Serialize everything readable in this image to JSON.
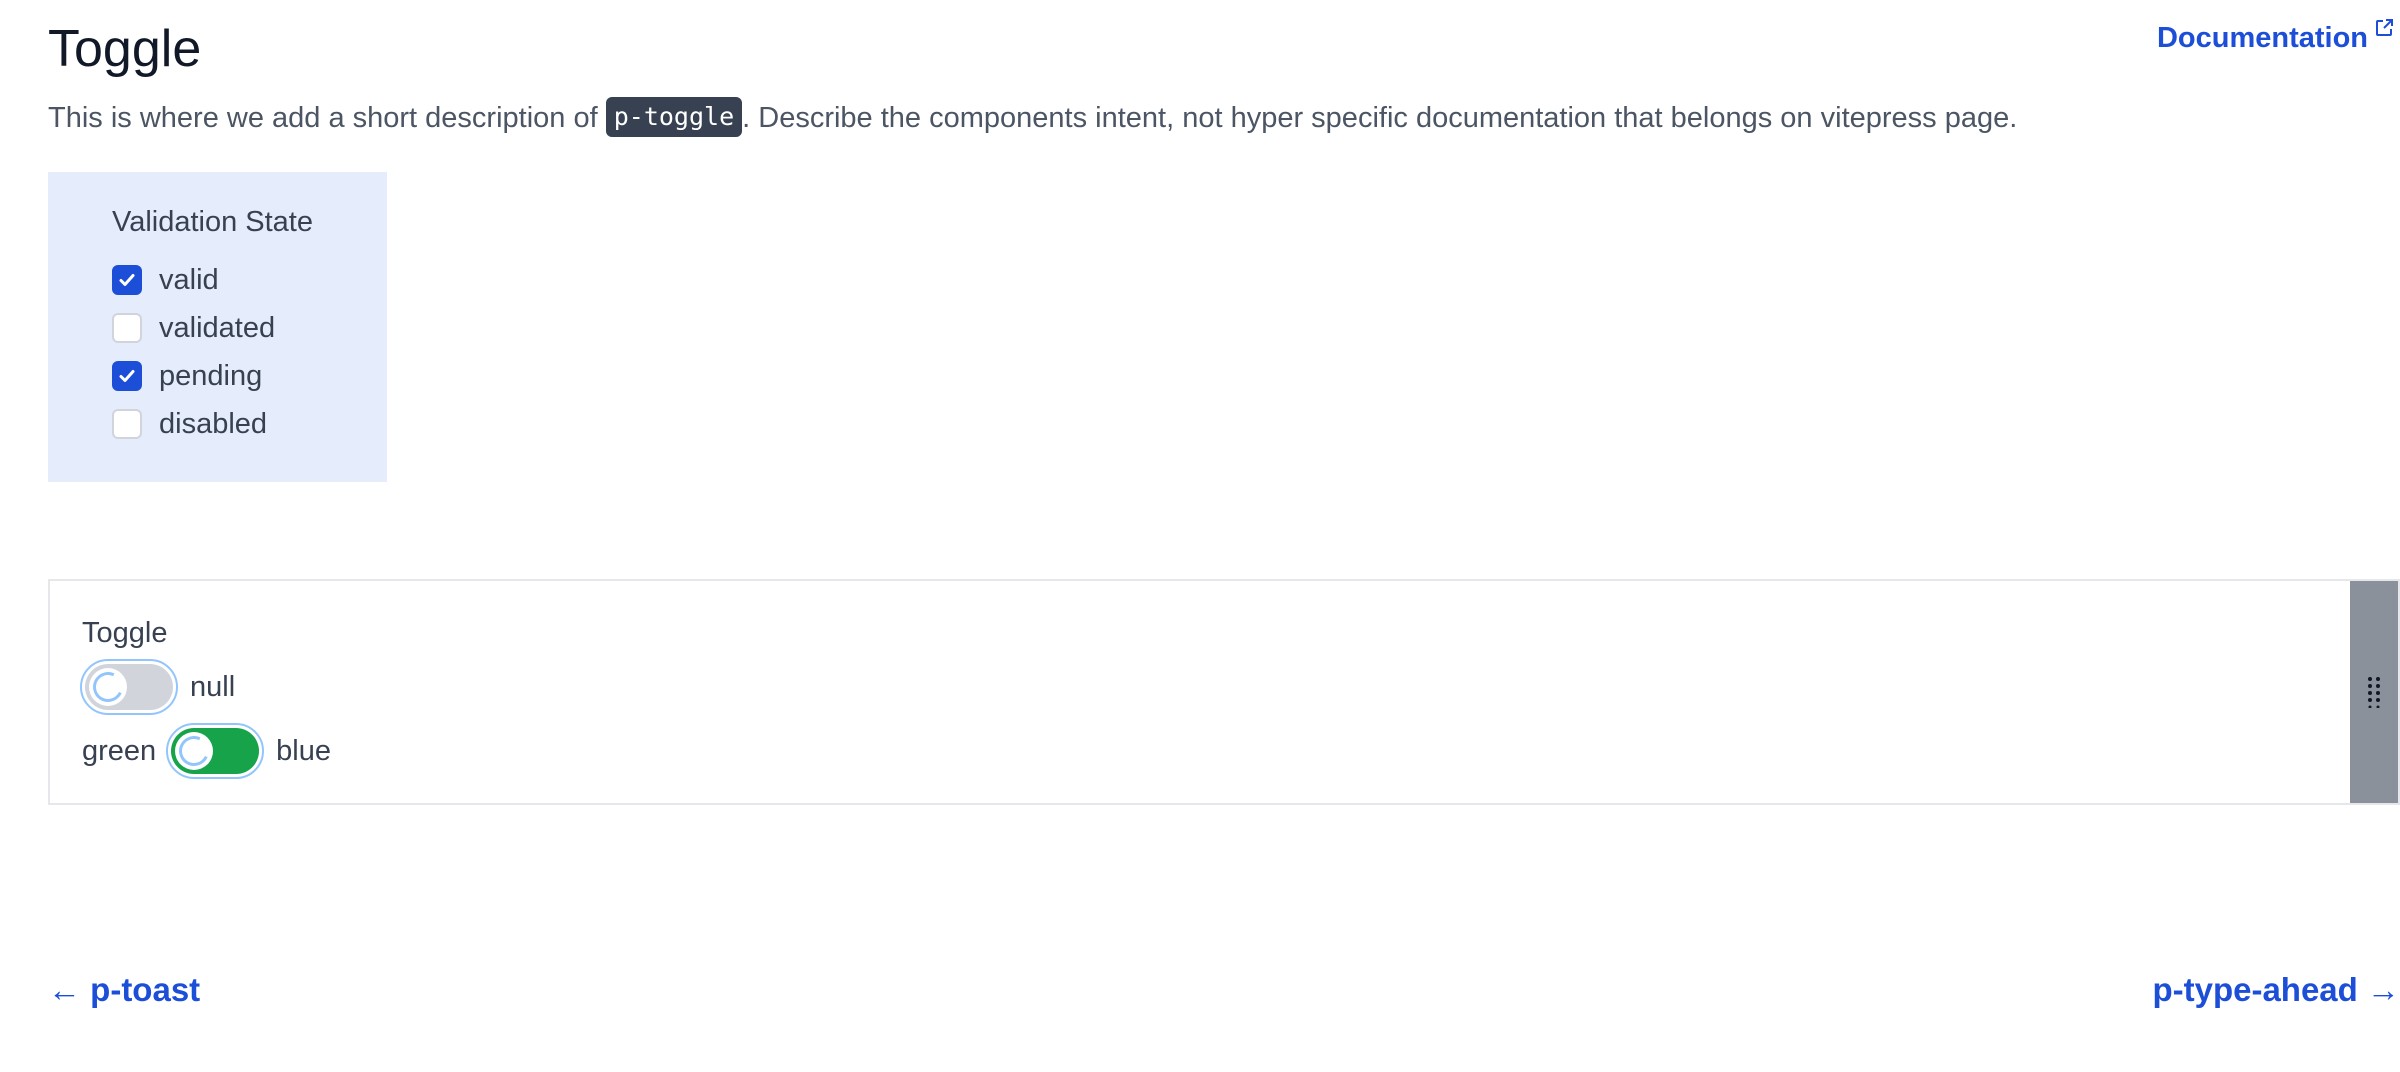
{
  "header": {
    "title": "Toggle",
    "documentation_link": "Documentation"
  },
  "description": {
    "before": "This is where we add a short description of ",
    "code": "p-toggle",
    "after": ". Describe the components intent, not hyper specific documentation that belongs on vitepress page."
  },
  "validation_state": {
    "heading": "Validation State",
    "options": [
      {
        "label": "valid",
        "checked": true
      },
      {
        "label": "validated",
        "checked": false
      },
      {
        "label": "pending",
        "checked": true
      },
      {
        "label": "disabled",
        "checked": false
      }
    ]
  },
  "demo": {
    "label": "Toggle",
    "toggle1": {
      "after_label": "null",
      "state": "off",
      "pending": true
    },
    "toggle2": {
      "before_label": "green",
      "after_label": "blue",
      "state": "on",
      "pending": true
    }
  },
  "pagination": {
    "prev": "← p-toast",
    "next": "p-type-ahead →"
  },
  "colors": {
    "accent": "#1d4ed8",
    "toggle_on": "#16a34a",
    "toggle_off": "#d1d5db",
    "panel_bg": "#e5edfd",
    "code_bg": "#374151",
    "drag_handle": "#8b919a"
  },
  "icons": {
    "external": "external-link-icon",
    "check": "check-icon",
    "drag": "drag-handle-icon",
    "spinner": "loading-spinner-icon"
  }
}
